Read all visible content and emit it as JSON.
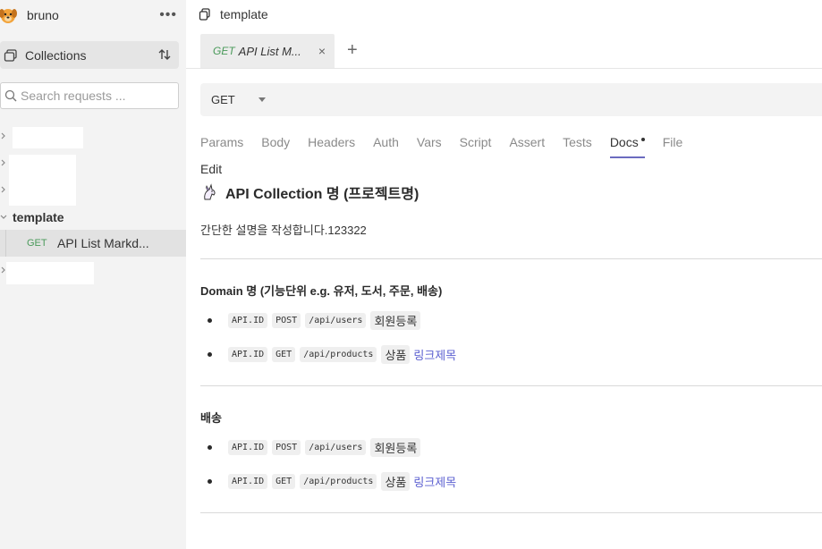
{
  "sidebar": {
    "brand": "bruno",
    "more": "•••",
    "collections_label": "Collections",
    "search_placeholder": "Search requests ...",
    "tree": {
      "folder_label": "template",
      "request_method": "GET",
      "request_name": "API List Markd..."
    }
  },
  "workspace": {
    "title": "template"
  },
  "tab": {
    "method": "GET",
    "name": "API List M...",
    "close": "×",
    "new": "+"
  },
  "url_bar": {
    "method": "GET"
  },
  "subtabs": [
    "Params",
    "Body",
    "Headers",
    "Auth",
    "Vars",
    "Script",
    "Assert",
    "Tests",
    "Docs",
    "File"
  ],
  "active_subtab": "Docs",
  "docs": {
    "edit_label": "Edit",
    "title": "API Collection 명 (프로젝트명)",
    "description": "간단한 설명을 작성합니다.123322",
    "sections": [
      {
        "heading": "Domain 명 (기능단위 e.g. 유저, 도서, 주문, 배송)",
        "items": [
          {
            "id": "API.ID",
            "method": "POST",
            "path": "/api/users",
            "desc": "회원등록",
            "link": ""
          },
          {
            "id": "API.ID",
            "method": "GET",
            "path": "/api/products",
            "desc": "상품",
            "link": "링크제목"
          }
        ]
      },
      {
        "heading": "배송",
        "items": [
          {
            "id": "API.ID",
            "method": "POST",
            "path": "/api/users",
            "desc": "회원등록",
            "link": ""
          },
          {
            "id": "API.ID",
            "method": "GET",
            "path": "/api/products",
            "desc": "상품",
            "link": "링크제목"
          }
        ]
      }
    ]
  },
  "colors": {
    "sidebar_bg": "#f3f3f3",
    "method_get": "#4a9a5a",
    "active_tab_underline": "#6b6bbf",
    "link": "#5b5fd0"
  }
}
